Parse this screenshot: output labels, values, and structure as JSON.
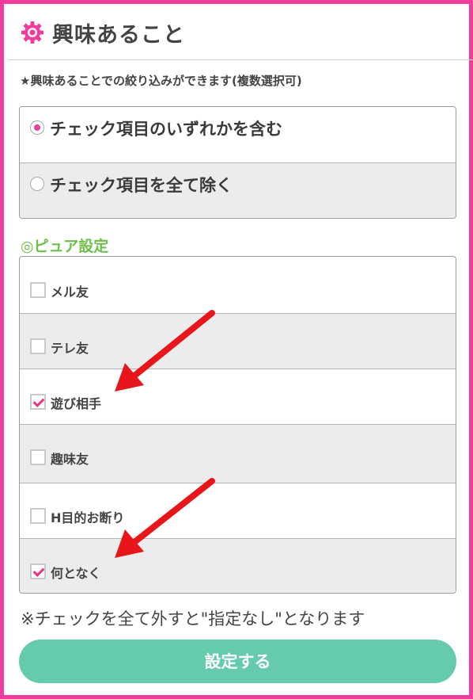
{
  "header": {
    "title": "興味あること",
    "icon": "gear-icon",
    "accent_color": "#f03c9c"
  },
  "intro_note": "★興味あることでの絞り込みができます(複数選択可)",
  "match_mode": {
    "options": [
      {
        "label": "チェック項目のいずれかを含む",
        "selected": true
      },
      {
        "label": "チェック項目を全て除く",
        "selected": false
      }
    ]
  },
  "pure_section": {
    "title": "◎ピュア設定",
    "title_color": "#6cc04a",
    "items": [
      {
        "label": "メル友",
        "checked": false
      },
      {
        "label": "テレ友",
        "checked": false
      },
      {
        "label": "遊び相手",
        "checked": true
      },
      {
        "label": "趣味友",
        "checked": false
      },
      {
        "label": "H目的お断り",
        "checked": false
      },
      {
        "label": "何となく",
        "checked": true
      }
    ]
  },
  "footnote": "※チェックを全て外すと\"指定なし\"となります",
  "submit": {
    "label": "設定する",
    "color": "#66cbad"
  },
  "annotations": {
    "arrow_color": "#e8151b"
  }
}
